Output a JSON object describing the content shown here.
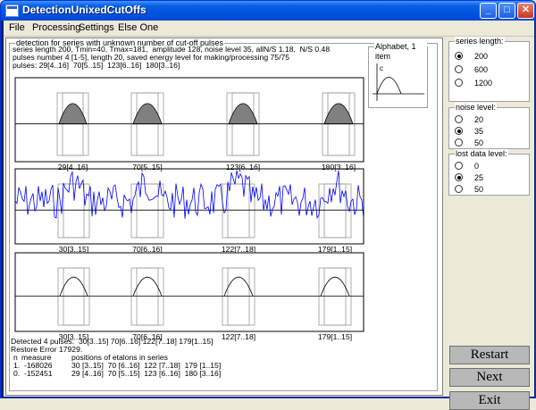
{
  "window": {
    "title": "DetectionUnixedCutOffs"
  },
  "titlebar_buttons": [
    "_",
    "□",
    "✕"
  ],
  "menu": [
    "File",
    "Processing",
    "Settings",
    "Else One"
  ],
  "main_group_title": "detection for series with unknown number of cut-off pulses",
  "info_lines": [
    "series length 200, Tmin=40, Tmax=181,  amplitude 128, noise level 35, allN/S 1.18,  N/S 0.48",
    "pulses number 4 [1-5], length 20, saved energy level for making/processing 75/75",
    "pulses: 29[4..16]  70[5..15]  123[6..16]  180[3..16]"
  ],
  "alphabet": {
    "title": "Alphabet, 1 item",
    "label": "c"
  },
  "plots": [
    {
      "name": "source",
      "labels": [
        "29[4..16]",
        "70[5..15]",
        "123[6..16]",
        "180[3..16]"
      ]
    },
    {
      "name": "noisy",
      "labels": [
        "30[3..15]",
        "70[6..16]",
        "122[7..18]",
        "179[1..15]"
      ]
    },
    {
      "name": "restored",
      "labels": [
        "30[3..15]",
        "70[6..16]",
        "122[7..18]",
        "179[1..15]"
      ]
    }
  ],
  "results": {
    "detected": "Detected 4 pulses:  30[3..15] 70[6..16] 122[7..18] 179[1..15]",
    "restore_error": "Restore Error 17929.",
    "header_n": "n",
    "header_measure": "measure",
    "header_positions": "positions of etalons in series",
    "rows": [
      {
        "n": "1.",
        "measure": "-168026",
        "positions": "30 [3..15]  70 [6..16]  122 [7..18]  179 [1..15]"
      },
      {
        "n": "0.",
        "measure": "-152451",
        "positions": "29 [4..16]  70 [5..15]  123 [6..16]  180 [3..16]"
      }
    ]
  },
  "series_length": {
    "title": "series length:",
    "options": [
      "200",
      "600",
      "1200"
    ],
    "selected": "200"
  },
  "noise_level": {
    "title": "noise level:",
    "options": [
      "20",
      "35",
      "50"
    ],
    "selected": "35"
  },
  "lost_data_level": {
    "title": "lost data level:",
    "options": [
      "0",
      "25",
      "50"
    ],
    "selected": "25"
  },
  "buttons": {
    "restart": "Restart",
    "next": "Next",
    "exit": "Exit"
  },
  "colors": {
    "titlebar": "#0054e3",
    "signal": "#0000ff",
    "pulse_fill": "#808080",
    "button_face": "#b8b8b8",
    "window_bg": "#ece9d8"
  }
}
